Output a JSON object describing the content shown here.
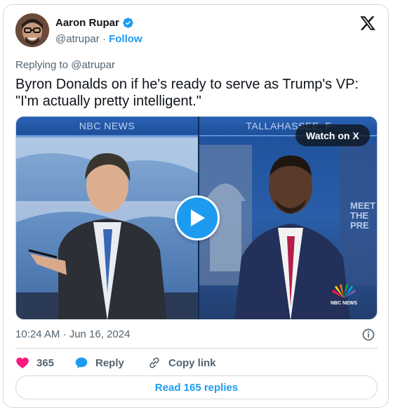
{
  "author": {
    "name": "Aaron Rupar",
    "handle": "@atrupar",
    "separator": "·",
    "follow_label": "Follow"
  },
  "tweet": {
    "replying_to": "Replying to @atrupar",
    "text_line1": "Byron Donalds on if he's ready to serve as Trump's VP:",
    "text_line2": "\"I'm actually pretty intelligent.\""
  },
  "media": {
    "left_caption": "NBC NEWS",
    "right_caption": "TALLAHASSEE, F",
    "watch_label": "Watch on X",
    "bug_text": "NBC NEWS",
    "meet_text_1": "MEET",
    "meet_text_2": "THE PRE"
  },
  "meta": {
    "timestamp": "10:24 AM · Jun 16, 2024"
  },
  "actions": {
    "like_count": "365",
    "reply_label": "Reply",
    "copy_label": "Copy link"
  },
  "read_replies_label": "Read 165 replies",
  "colors": {
    "accent": "#1d9bf0",
    "like": "#f91880",
    "text_secondary": "#536471"
  },
  "icons": [
    "x-logo-icon",
    "verified-badge-icon",
    "play-icon",
    "info-icon",
    "heart-icon",
    "reply-bubble-icon",
    "link-icon"
  ]
}
